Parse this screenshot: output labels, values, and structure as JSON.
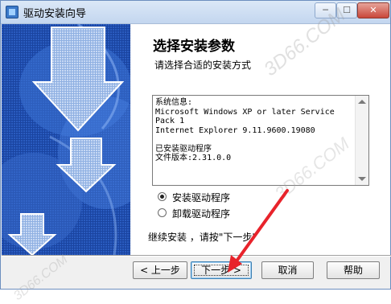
{
  "window": {
    "title": "驱动安装向导",
    "controls": [
      "minimize",
      "maximize",
      "close"
    ],
    "close_glyph": "✕"
  },
  "page": {
    "heading": "选择安装参数",
    "subheading": "请选择合适的安装方式"
  },
  "info_box": {
    "text": "系统信息:\nMicrosoft Windows XP or later Service\nPack 1\nInternet Explorer 9.11.9600.19080\n\n已安装驱动程序\n文件版本:2.31.0.0"
  },
  "options": {
    "selected": "install",
    "install_label": "安装驱动程序",
    "uninstall_label": "卸载驱动程序"
  },
  "hint": "继续安装 ，请按\"下一步\"",
  "buttons": {
    "back": "< 上一步",
    "next": "下一步 >",
    "cancel": "取消",
    "help": "帮助"
  },
  "watermark": {
    "text": "3D66.COM"
  },
  "colors": {
    "side_panel": "#1d4aa8",
    "annotation_arrow": "#e8232b"
  }
}
